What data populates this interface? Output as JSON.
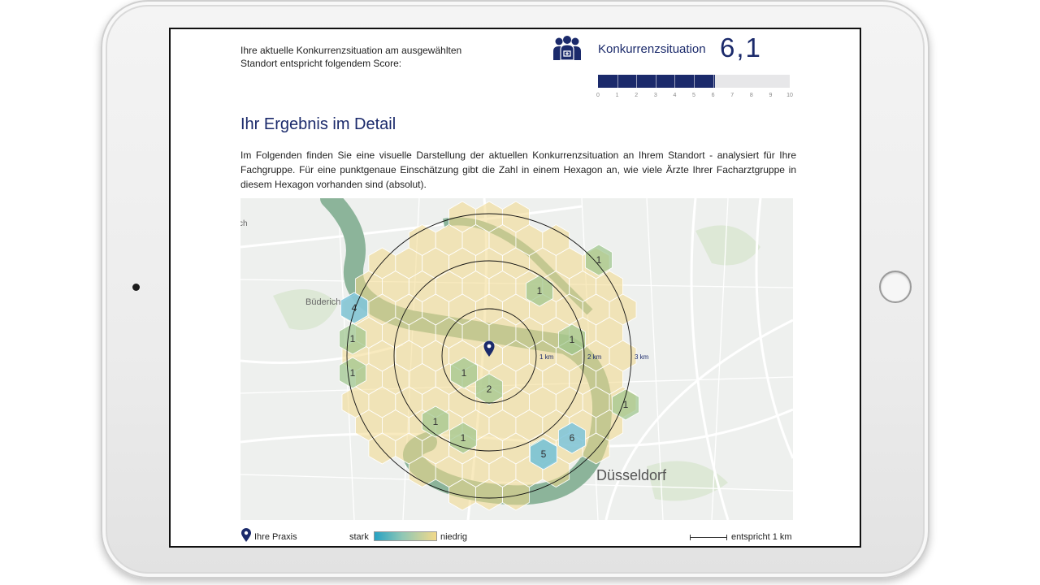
{
  "report": {
    "intro_text": "Ihre aktuelle Konkurrenzsituation am ausgewählten Standort entspricht folgendem Score:",
    "score_label": "Konkurrenzsituation",
    "score_value": "6,1",
    "score_numeric": 6.1,
    "score_max": 10,
    "score_ticks": [
      "0",
      "1",
      "2",
      "3",
      "4",
      "5",
      "6",
      "7",
      "8",
      "9",
      "10"
    ],
    "icon": "doctors-group-icon",
    "detail_title": "Ihr Ergebnis im Detail",
    "detail_text": "Im Folgenden finden Sie eine visuelle Darstellung der aktuellen Konkurrenzsituation an Ihrem Standort - analysiert für Ihre Fachgruppe. Für eine punktgenaue Einschätzung gibt die Zahl in einem Hexagon an, wie viele Ärzte Ihrer Facharztgruppe in diesem Hexagon vorhanden sind (absolut)."
  },
  "map": {
    "place_labels": [
      "ch",
      "Büderich",
      "Düsseldorf"
    ],
    "ring_labels": [
      "1 km",
      "2 km",
      "3 km"
    ],
    "hex_counts": [
      "1",
      "1",
      "4",
      "1",
      "1",
      "1",
      "1",
      "1",
      "2",
      "1",
      "1",
      "1",
      "6",
      "5"
    ],
    "marker_icon": "location-pin-icon"
  },
  "legend": {
    "praxis_label": "Ihre Praxis",
    "stark_label": "stark",
    "niedrig_label": "niedrig",
    "scale_label": "entspricht 1 km"
  },
  "colors": {
    "brand": "#1b2a6b",
    "hex_low": "#f2d98a",
    "hex_medium": "#9cc48c",
    "hex_high": "#7cc4dc",
    "river": "#8cb49a",
    "background": "#eef0ee"
  }
}
